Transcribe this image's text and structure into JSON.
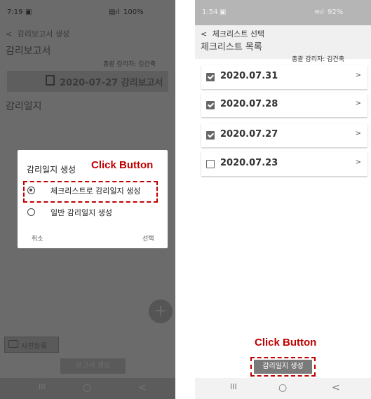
{
  "left": {
    "status": {
      "time": "7:19",
      "signal": "100%"
    },
    "back_title": "감리보고서 생성",
    "section_title": "감리보고서",
    "supervisor": "총괄 감리자: 김건축",
    "report_title": "2020-07-27 감리보고서",
    "log_title": "감리일지",
    "dialog": {
      "title": "감리일지 생성",
      "options": [
        "체크리스트로 감리일지 생성",
        "일반 감리일지 생성"
      ],
      "cancel": "취소",
      "select": "선택"
    },
    "annotation": "Click Button",
    "fab": "+",
    "photo_button": "사진등록",
    "create_report_button": "보고서 생성"
  },
  "right": {
    "status": {
      "time": "1:54",
      "signal": "92%"
    },
    "back_title": "체크리스트 선택",
    "section_title": "체크리스트 목록",
    "supervisor": "총괄 감리자: 김건축",
    "items": [
      {
        "date": "2020.07.31",
        "checked": true,
        "arrow": ">"
      },
      {
        "date": "2020.07.28",
        "checked": true,
        "arrow": ">"
      },
      {
        "date": "2020.07.27",
        "checked": true,
        "arrow": ">"
      },
      {
        "date": "2020.07.23",
        "checked": false,
        "arrow": ">"
      }
    ],
    "annotation": "Click Button",
    "create_log_button": "감리일지 생성"
  },
  "nav": {
    "recent": "III",
    "home": "○",
    "back": "<"
  },
  "colors": {
    "annotation": "#c00000",
    "dim_overlay": "#6b6b6b",
    "button_gray": "#7a7a7a"
  }
}
